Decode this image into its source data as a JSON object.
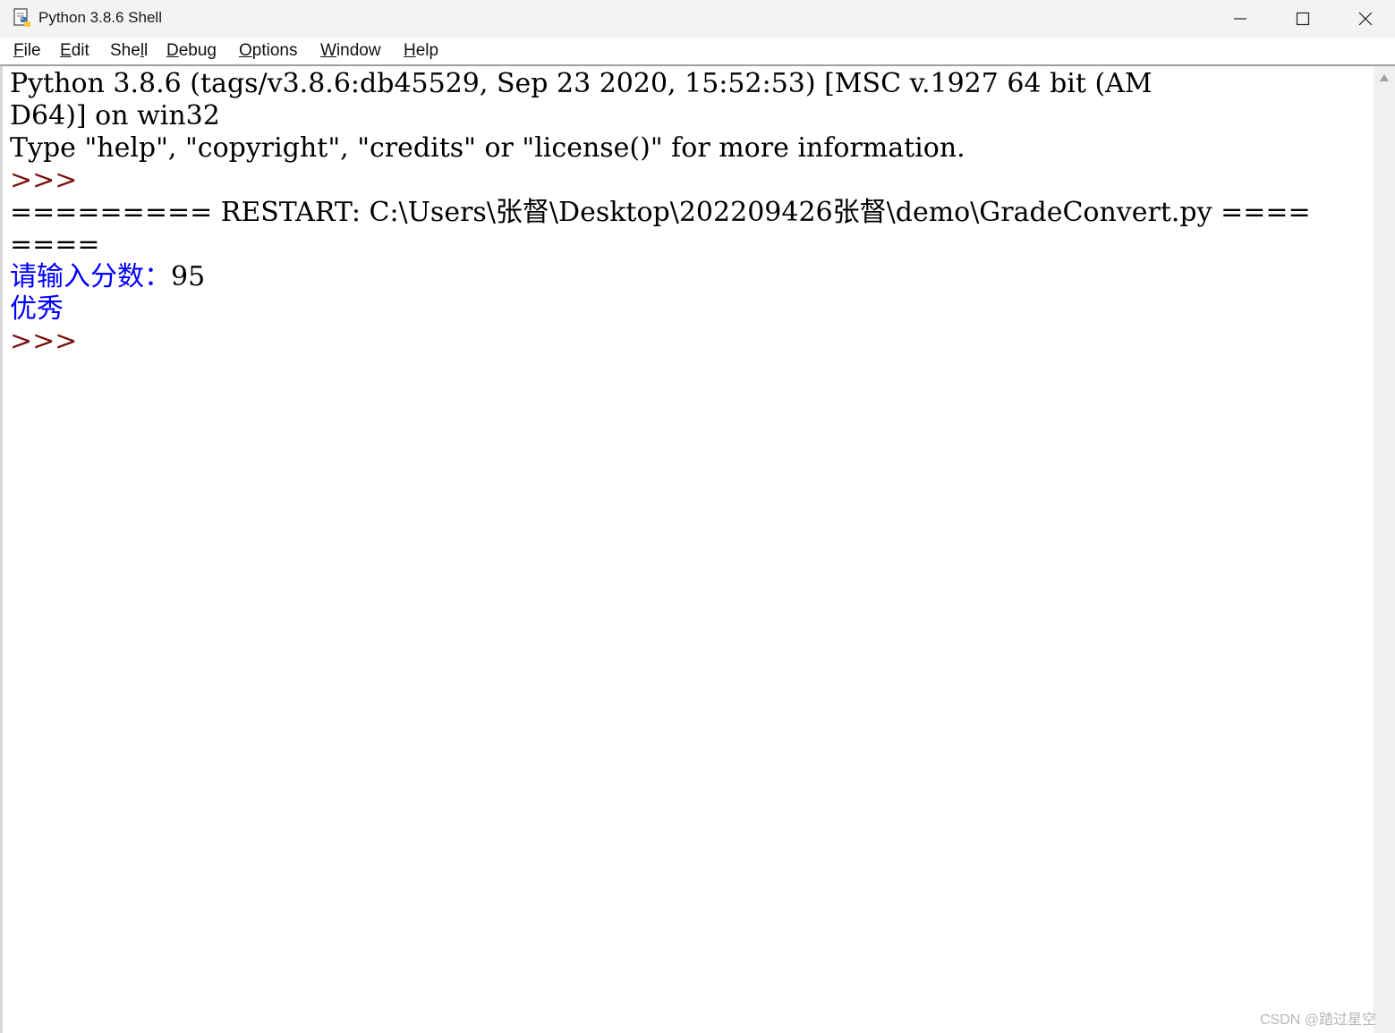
{
  "window": {
    "title": "Python 3.8.6 Shell"
  },
  "menu": {
    "file": {
      "mnemonic": "F",
      "rest": "ile"
    },
    "edit": {
      "mnemonic": "E",
      "rest": "dit"
    },
    "shell": {
      "prefix": "She",
      "mnemonic": "l",
      "rest": "l"
    },
    "debug": {
      "mnemonic": "D",
      "rest": "ebug"
    },
    "options": {
      "mnemonic": "O",
      "rest": "ptions"
    },
    "window": {
      "mnemonic": "W",
      "rest": "indow"
    },
    "help": {
      "mnemonic": "H",
      "rest": "elp"
    }
  },
  "shell": {
    "banner_line1": "Python 3.8.6 (tags/v3.8.6:db45529, Sep 23 2020, 15:52:53) [MSC v.1927 64 bit (AM",
    "banner_line2": "D64)] on win32",
    "banner_line3": "Type \"help\", \"copyright\", \"credits\" or \"license()\" for more information.",
    "prompt1": ">>>",
    "restart_line1": "========= RESTART: C:\\Users\\张督\\Desktop\\202209426张督\\demo\\GradeConvert.py ====",
    "restart_line2": "====",
    "input_prompt": "请输入分数：",
    "input_value": "95",
    "output": "优秀",
    "prompt2": ">>>"
  },
  "watermark": "CSDN @踏过星空",
  "colors": {
    "prompt": "#7a1010",
    "program_output": "#0000ff",
    "text": "#000000"
  },
  "icons": {
    "app": "python-idle-icon",
    "minimize": "minimize-icon",
    "maximize": "maximize-icon",
    "close": "close-icon",
    "scroll_up": "scroll-up-arrow-icon"
  }
}
